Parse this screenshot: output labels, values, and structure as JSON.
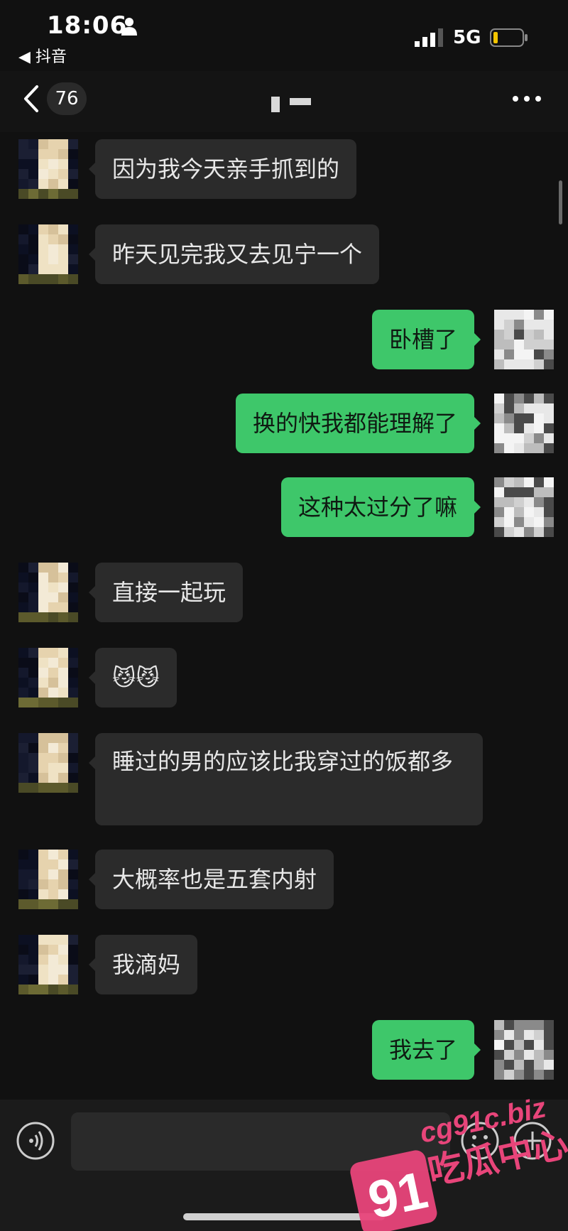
{
  "status_bar": {
    "time": "18:06",
    "back_app": "◀ 抖音",
    "network": "5G"
  },
  "nav": {
    "unread_count": "76"
  },
  "messages": [
    {
      "side": "in",
      "text": "因为我今天亲手抓到的"
    },
    {
      "side": "in",
      "text": "昨天见完我又去见宁一个"
    },
    {
      "side": "out",
      "text": "卧槽了"
    },
    {
      "side": "out",
      "text": "换的快我都能理解了"
    },
    {
      "side": "out",
      "text": "这种太过分了嘛"
    },
    {
      "side": "in",
      "text": "直接一起玩"
    },
    {
      "side": "in",
      "text": "😼😼"
    },
    {
      "side": "in",
      "text": "睡过的男的应该比我穿过的饭都多"
    },
    {
      "side": "in",
      "text": "大概率也是五套内射"
    },
    {
      "side": "in",
      "text": "我滴妈"
    },
    {
      "side": "out",
      "text": "我去了"
    }
  ],
  "watermark": {
    "number": "91",
    "domain": "cg91c.biz",
    "name": "吃瓜中心"
  },
  "colors": {
    "background": "#111111",
    "bubble_in": "#2b2b2b",
    "bubble_out": "#3ec76a",
    "watermark": "#e8457a"
  }
}
